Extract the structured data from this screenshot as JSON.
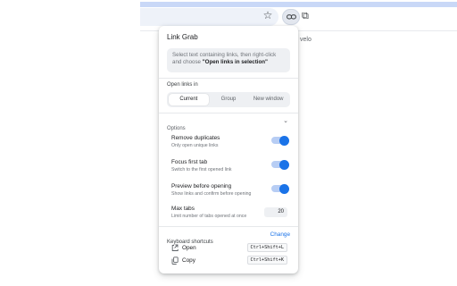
{
  "page": {
    "fragment_text": "velo"
  },
  "popup": {
    "title": "Link Grab",
    "hint_prefix": "Select text containing links, then right-click and choose ",
    "hint_bold": "\"Open links in selection\"",
    "open_links_in": {
      "label": "Open links in",
      "options": [
        "Current",
        "Group",
        "New window"
      ],
      "selected": "Current"
    },
    "options_section": {
      "label": "Options",
      "items": [
        {
          "title": "Remove duplicates",
          "subtitle": "Only open unique links",
          "enabled": true
        },
        {
          "title": "Focus first tab",
          "subtitle": "Switch to the first opened link",
          "enabled": true
        },
        {
          "title": "Preview before opening",
          "subtitle": "Show links and confirm before opening",
          "enabled": true
        }
      ],
      "max_tabs": {
        "title": "Max tabs",
        "subtitle": "Limit number of tabs opened at once",
        "value": "20"
      }
    },
    "shortcuts": {
      "label": "Keyboard shortcuts",
      "change_label": "Change",
      "items": [
        {
          "name": "Open",
          "keys": "Ctrl+Shift+L"
        },
        {
          "name": "Copy",
          "keys": "Ctrl+Shift+K"
        }
      ]
    }
  },
  "colors": {
    "accent": "#1a73e8",
    "track": "#b7cdf4"
  }
}
